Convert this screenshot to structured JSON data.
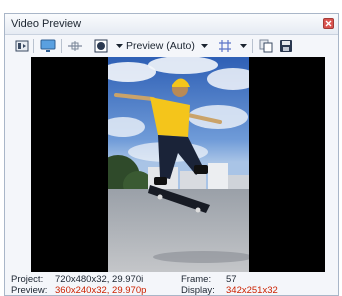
{
  "window": {
    "title": "Video Preview"
  },
  "toolbar": {
    "preview_quality": "Preview (Auto)"
  },
  "status": {
    "project_label": "Project:",
    "project_value": "720x480x32, 29.970i",
    "preview_label": "Preview:",
    "preview_value": "360x240x32, 29.970p",
    "frame_label": "Frame:",
    "frame_value": "57",
    "display_label": "Display:",
    "display_value": "342x251x32"
  },
  "colors": {
    "accent_red": "#cc2200",
    "close_button": "#d9534f"
  }
}
